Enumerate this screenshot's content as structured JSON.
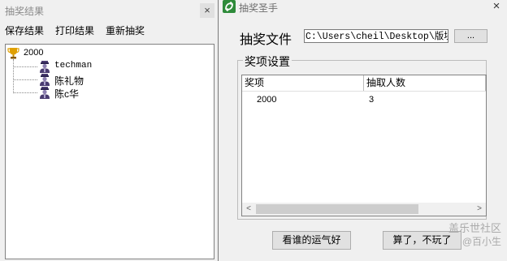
{
  "left_window": {
    "title": "抽奖结果",
    "close_glyph": "×",
    "menu": {
      "save": "保存结果",
      "print": "打印结果",
      "redraw": "重新抽奖"
    },
    "tree": {
      "root": "2000",
      "winners": [
        "techman",
        "陈礼物",
        "陈c华"
      ]
    }
  },
  "right_window": {
    "title": "抽奖圣手",
    "close_glyph": "×",
    "file_label": "抽奖文件",
    "file_path": "C:\\Users\\cheil\\Desktop\\版块活",
    "browse_label": "...",
    "group_title": "奖项设置",
    "columns": [
      "奖项",
      "抽取人数"
    ],
    "rows": [
      {
        "prize": "2000",
        "count": "3"
      }
    ],
    "scroll_left": "<",
    "scroll_right": ">",
    "luck_button": "看谁的运气好",
    "quit_button": "算了，不玩了"
  },
  "watermark": {
    "brand": "盖乐世社区",
    "user": "@百小生"
  },
  "icons": {
    "trophy": "trophy-icon",
    "person": "person-icon",
    "app": "app-logo-icon"
  },
  "colors": {
    "trophy": "#e0a000",
    "person": "#4a3c70",
    "app_logo": "#2e8b3a"
  }
}
